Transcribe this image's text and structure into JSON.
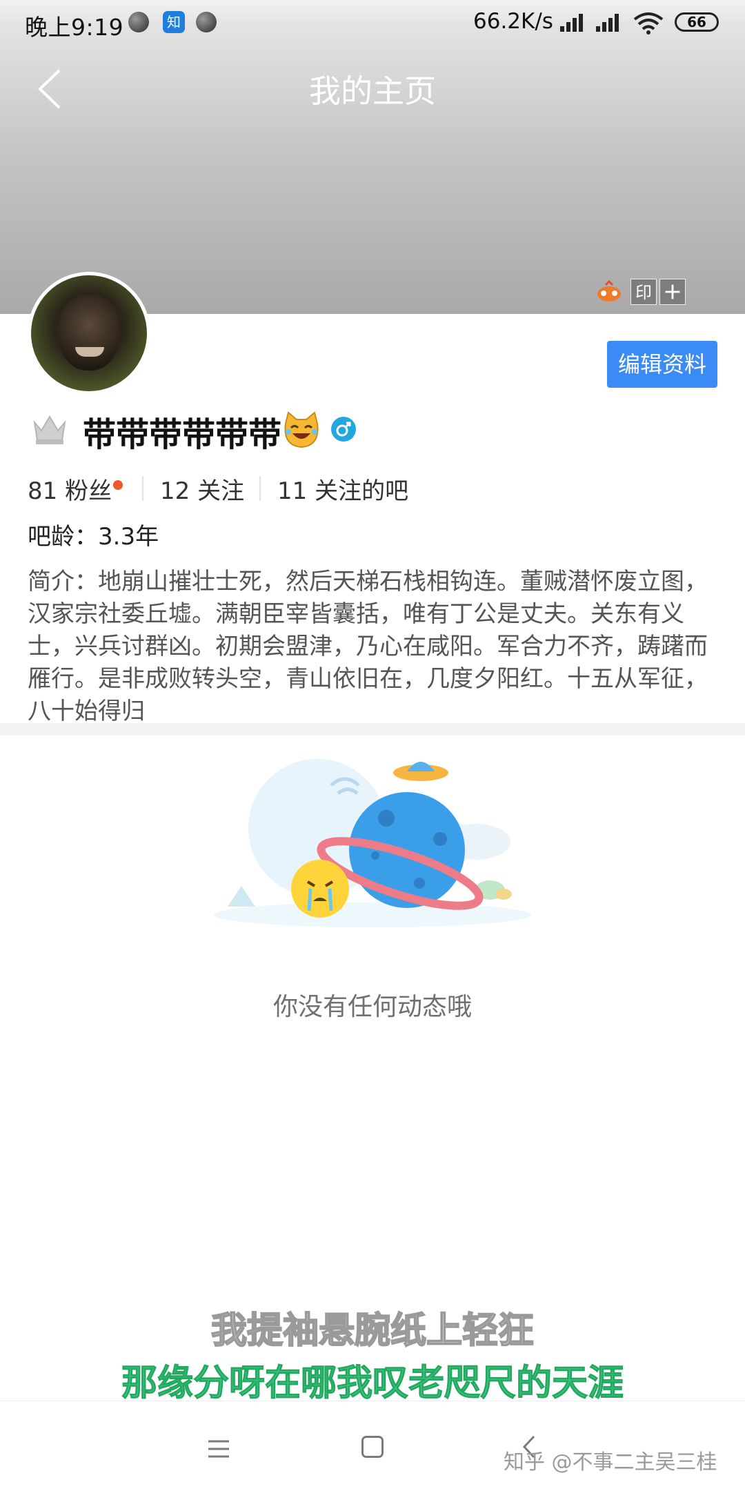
{
  "status_bar": {
    "time": "晚上9:19",
    "notification_app": "知",
    "network_speed": "66.2K/s",
    "battery": "66"
  },
  "header": {
    "title": "我的主页",
    "badge_label": "印"
  },
  "profile": {
    "edit_button": "编辑资料",
    "username": "带带带带带带",
    "stats": [
      {
        "count": "81",
        "label": "粉丝"
      },
      {
        "count": "12",
        "label": "关注"
      },
      {
        "count": "11",
        "label": "关注的吧"
      }
    ],
    "bar_age": "吧龄：3.3年",
    "bio": "简介：地崩山摧壮士死，然后天梯石栈相钩连。董贼潜怀废立图，汉家宗社委丘墟。满朝臣宰皆囊括，唯有丁公是丈夫。关东有义士，兴兵讨群凶。初期会盟津，乃心在咸阳。军合力不齐，踌躇而雁行。是非成败转头空，青山依旧在，几度夕阳红。十五从军征，八十始得归"
  },
  "empty_state": {
    "message": "你没有任何动态哦"
  },
  "subtitles": {
    "line1": "我提袖悬腕纸上轻狂",
    "line2": "那缘分呀在哪我叹老咫尺的天涯"
  },
  "watermark": "知乎 @不事二主吴三桂",
  "colors": {
    "accent_blue": "#3a8bf6",
    "subtitle_green": "#3cc884",
    "dot_orange": "#f0572a"
  }
}
